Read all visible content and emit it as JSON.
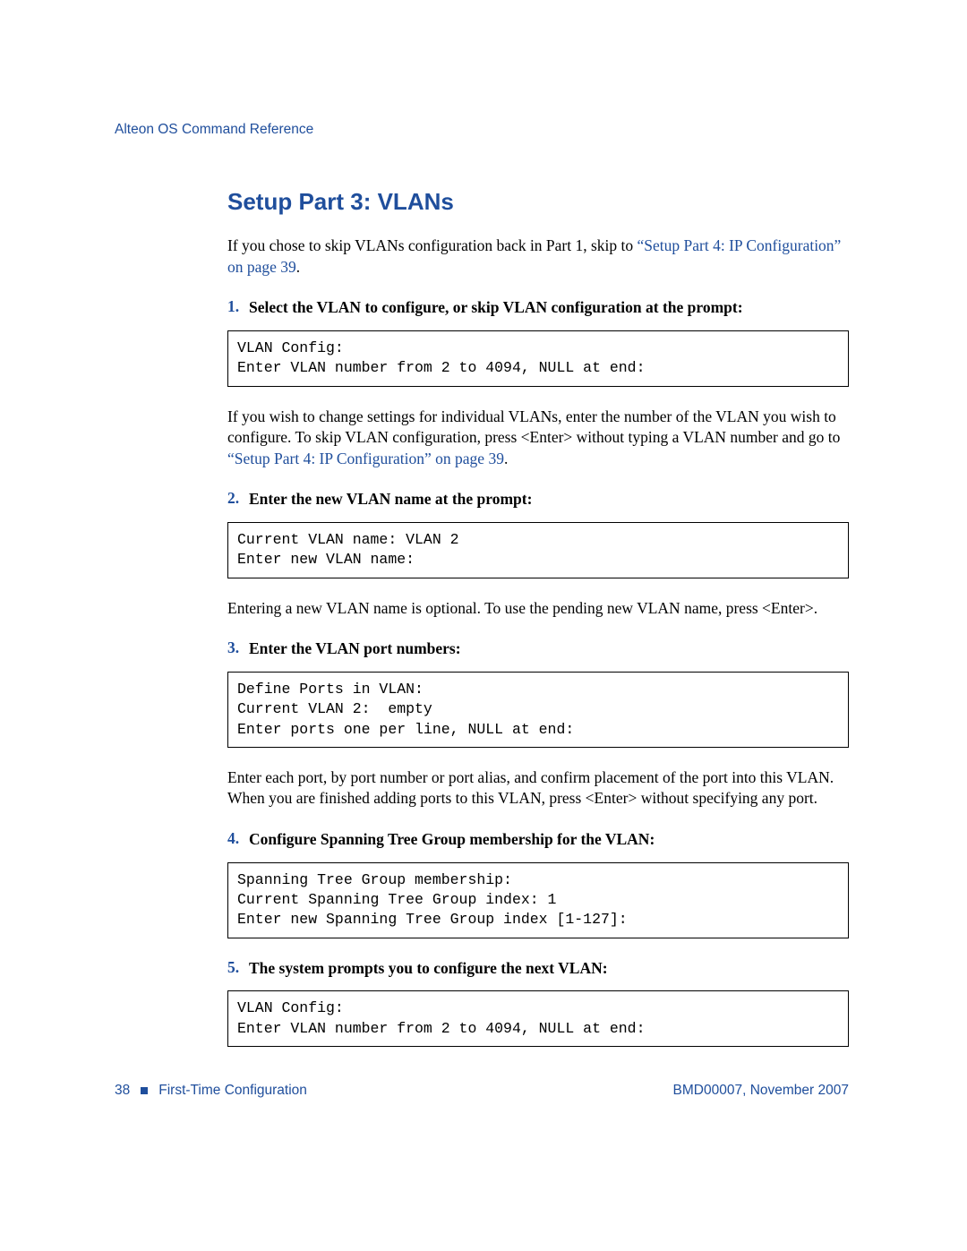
{
  "header": {
    "running_head": "Alteon OS Command Reference"
  },
  "title": "Setup Part 3: VLANs",
  "intro": {
    "pre": "If you chose to skip VLANs configuration back in Part 1, skip to ",
    "xref": "“Setup Part 4: IP Configuration” on page 39",
    "post": "."
  },
  "steps": [
    {
      "num": "1.",
      "text": "Select the VLAN to configure, or skip VLAN configuration at the prompt:",
      "code": "VLAN Config:\nEnter VLAN number from 2 to 4094, NULL at end:",
      "after_pre": "If you wish to change settings for individual VLANs, enter the number of the VLAN you wish to configure. To skip VLAN configuration, press <Enter> without typing a VLAN number and go to ",
      "after_xref": "“Setup Part 4: IP Configuration” on page 39",
      "after_post": "."
    },
    {
      "num": "2.",
      "text": "Enter the new VLAN name at the prompt:",
      "code": "Current VLAN name: VLAN 2\nEnter new VLAN name:",
      "after_plain": "Entering a new VLAN name is optional. To use the pending new VLAN name, press <Enter>."
    },
    {
      "num": "3.",
      "text": "Enter the VLAN port numbers:",
      "code": "Define Ports in VLAN:\nCurrent VLAN 2:  empty\nEnter ports one per line, NULL at end:",
      "after_plain": "Enter each port, by port number or port alias, and confirm placement of the port into this VLAN. When you are finished adding ports to this VLAN, press <Enter> without specifying any port."
    },
    {
      "num": "4.",
      "text": "Configure Spanning Tree Group membership for the VLAN:",
      "code": "Spanning Tree Group membership:\nCurrent Spanning Tree Group index: 1\nEnter new Spanning Tree Group index [1-127]:"
    },
    {
      "num": "5.",
      "text": "The system prompts you to configure the next VLAN:",
      "code": "VLAN Config:\nEnter VLAN number from 2 to 4094, NULL at end:"
    }
  ],
  "footer": {
    "page": "38",
    "chapter": "First-Time Configuration",
    "docid": "BMD00007, November 2007"
  }
}
